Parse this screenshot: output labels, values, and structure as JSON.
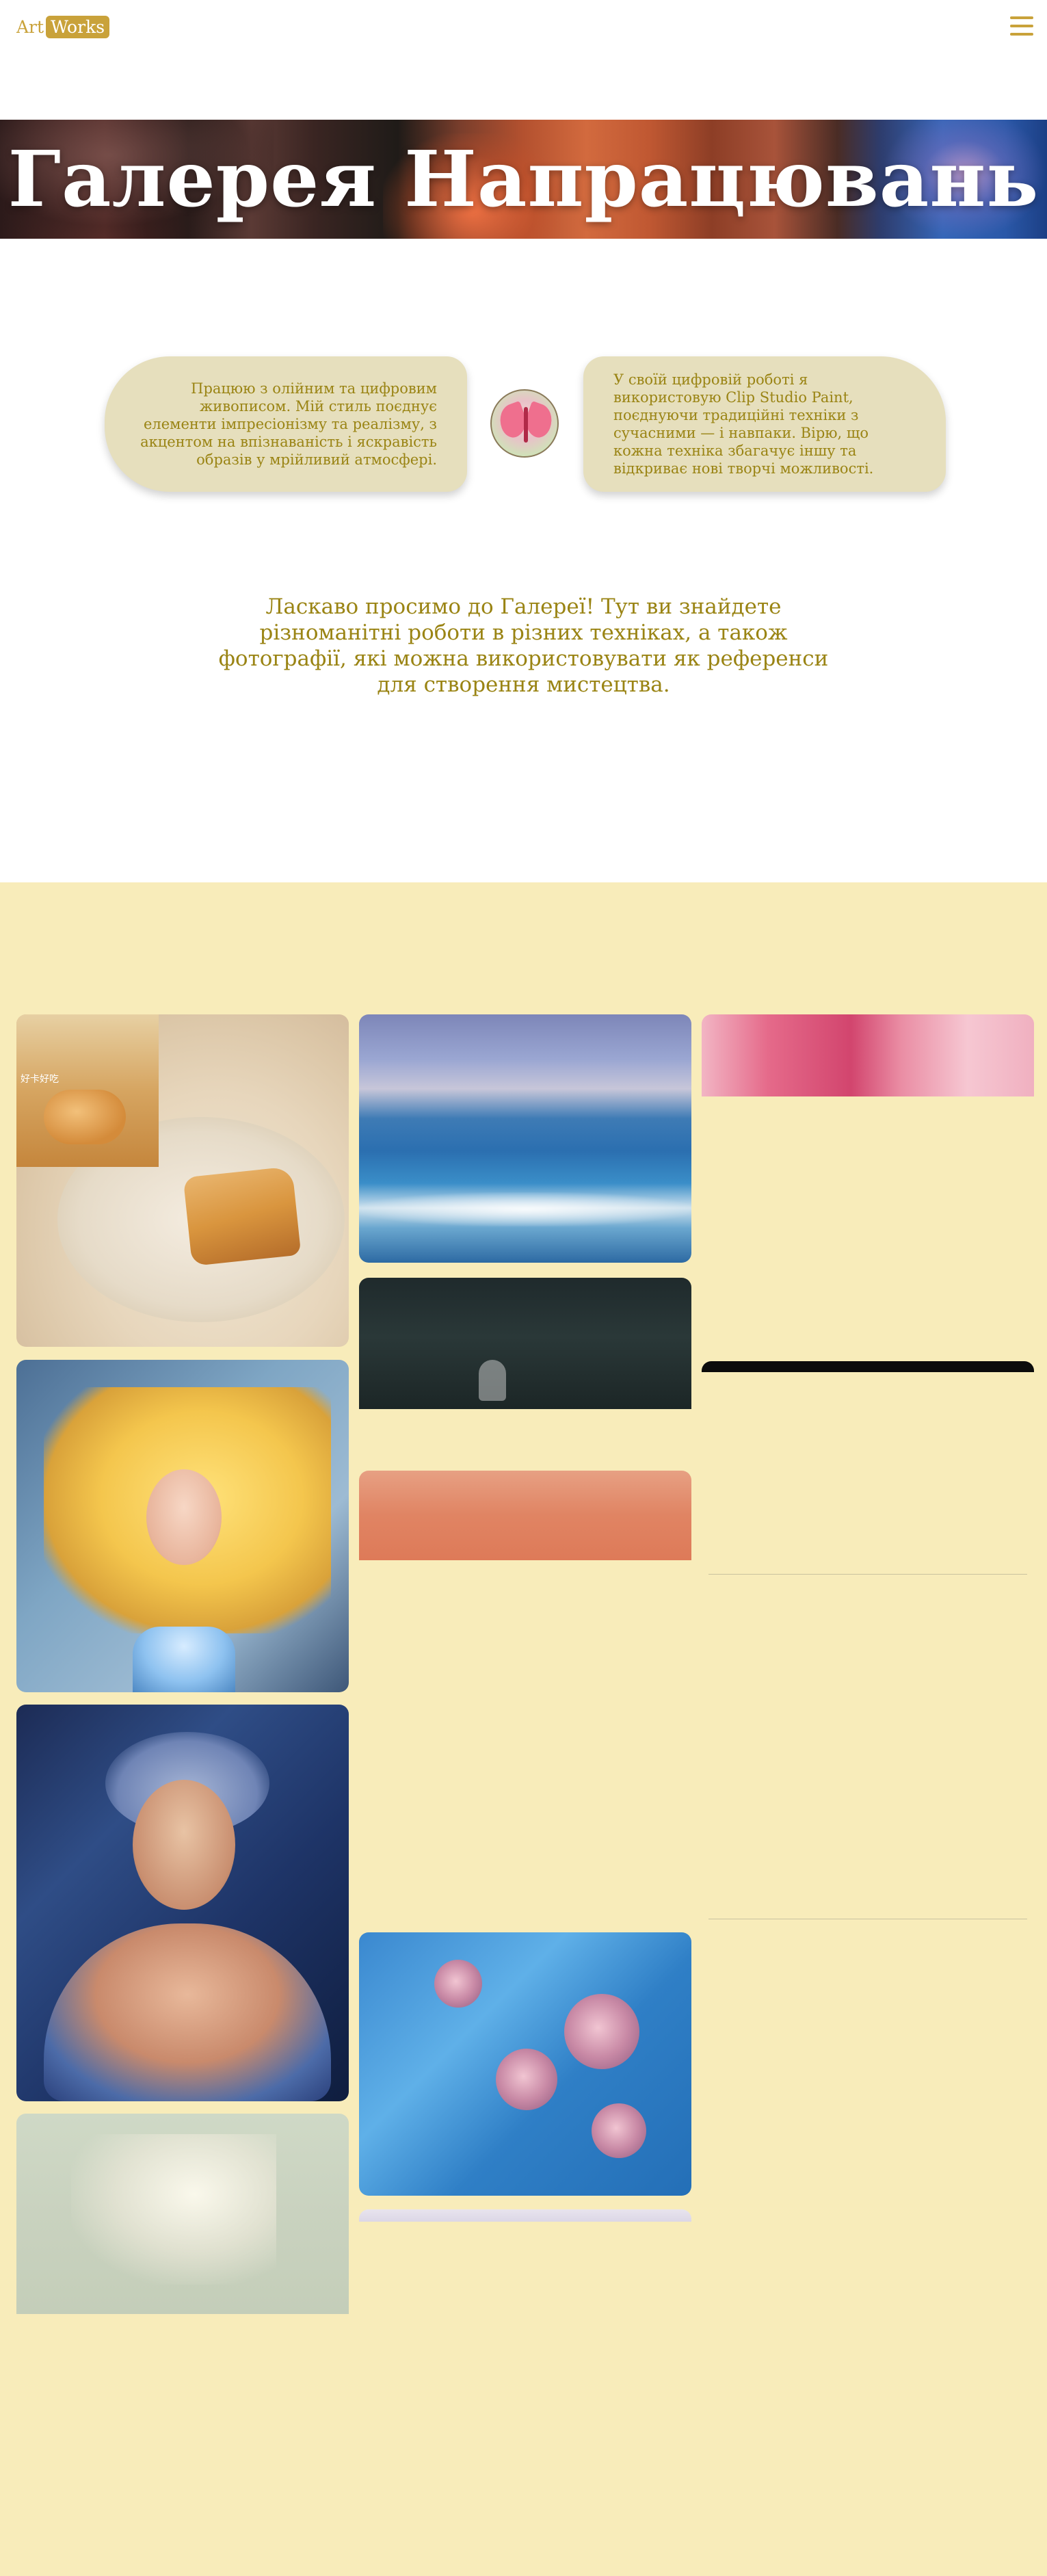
{
  "header": {
    "logo_art": "Art",
    "logo_works": "Works",
    "menu_icon": "hamburger-menu-icon"
  },
  "hero": {
    "title": "Галерея Напрацювань"
  },
  "intro": {
    "left_text": "Працюю з олійним та цифровим живописом. Мій стиль поєднує елементи імпресіонізму та реалізму, з акцентом на впізнаваність і яскравість образів у мрійливий атмосфері.",
    "right_text": "У своїй цифровій роботі я використовую Clip Studio Paint, поєднуючи традиційні техніки з сучасними — і навпаки. Вірю, що кожна техніка збагачує іншу та відкриває нові творчі можливості.",
    "avatar_icon": "butterfly-avatar-icon"
  },
  "welcome": {
    "text": "Ласкаво просимо до Галереї! Тут ви знайдете різноманітні роботи в різних техніках, а також фотографії, які можна використовувати як референси для створення мистецтва."
  },
  "gallery": {
    "pastry_overlay_text": "好卡好吃"
  },
  "colors": {
    "accent": "#c9a23a",
    "text_olive": "#9a8414",
    "bubble": "#e6dfbd",
    "gallery_bg": "#f8ecba"
  }
}
